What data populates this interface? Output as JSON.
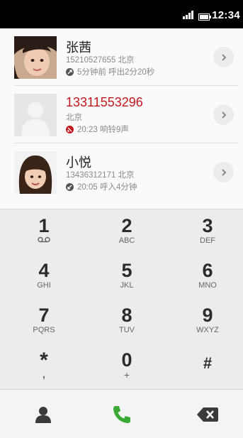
{
  "status_bar": {
    "time": "12:34",
    "signal_icon": "signal-icon",
    "battery_icon": "battery-icon"
  },
  "call_log": [
    {
      "name": "张茜",
      "detail": "15210527655 北京",
      "type_icon": "outgoing-call-icon",
      "info": "5分钟前 呼出2分20秒",
      "has_photo": true,
      "accent": "#555555"
    },
    {
      "name": "13311553296",
      "detail": "北京",
      "type_icon": "missed-call-icon",
      "info": "20:23 响铃9声",
      "has_photo": false,
      "accent": "#c4161c"
    },
    {
      "name": "小悦",
      "detail": "13436312171 北京",
      "type_icon": "incoming-call-icon",
      "info": "20:05 呼入4分钟",
      "has_photo": true,
      "accent": "#555555"
    }
  ],
  "keypad": [
    {
      "digit": "1",
      "letters": "voicemail"
    },
    {
      "digit": "2",
      "letters": "ABC"
    },
    {
      "digit": "3",
      "letters": "DEF"
    },
    {
      "digit": "4",
      "letters": "GHI"
    },
    {
      "digit": "5",
      "letters": "JKL"
    },
    {
      "digit": "6",
      "letters": "MNO"
    },
    {
      "digit": "7",
      "letters": "PQRS"
    },
    {
      "digit": "8",
      "letters": "TUV"
    },
    {
      "digit": "9",
      "letters": "WXYZ"
    },
    {
      "digit": "*",
      "letters": ","
    },
    {
      "digit": "0",
      "letters": "+"
    },
    {
      "digit": "#",
      "letters": ""
    }
  ],
  "actions": {
    "contacts_icon": "contacts-icon",
    "call_icon": "call-icon",
    "backspace_icon": "backspace-icon",
    "call_color": "#3aaa35"
  }
}
